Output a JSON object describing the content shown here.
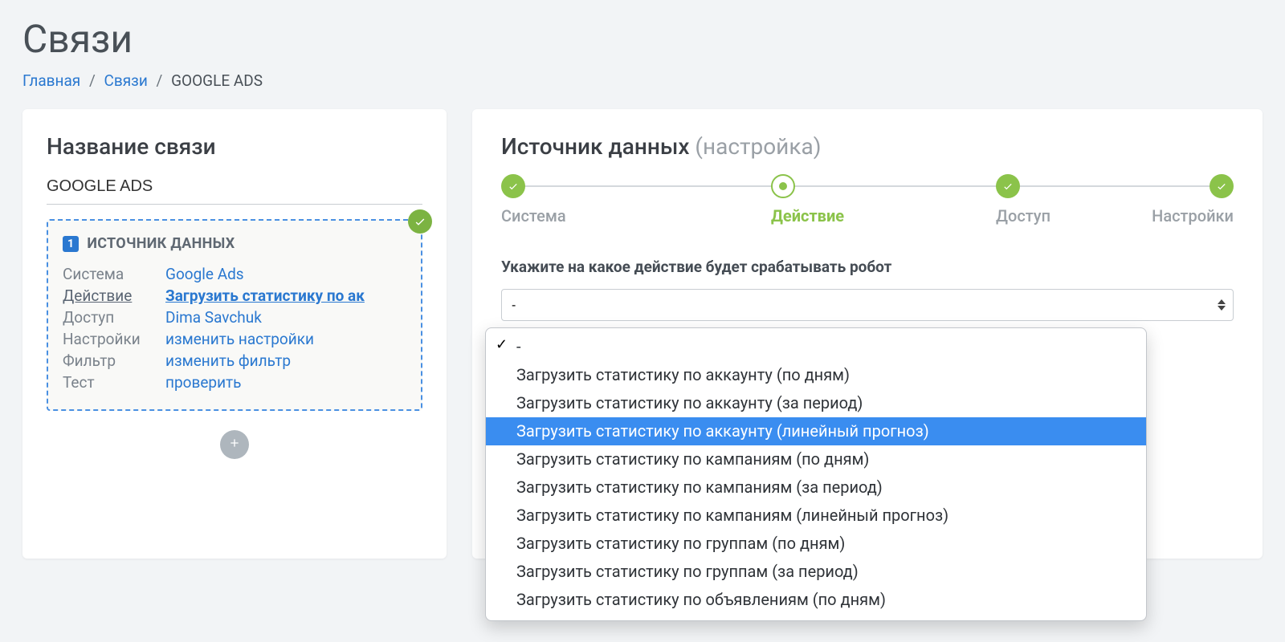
{
  "page": {
    "title": "Связи"
  },
  "breadcrumb": {
    "items": [
      {
        "label": "Главная",
        "link": true
      },
      {
        "label": "Связи",
        "link": true
      },
      {
        "label": "GOOGLE ADS",
        "link": false
      }
    ]
  },
  "left": {
    "title": "Название связи",
    "connection_name": "GOOGLE ADS",
    "source_block": {
      "step_number": "1",
      "header": "ИСТОЧНИК ДАННЫХ",
      "rows": [
        {
          "key": "Система",
          "value": "Google Ads",
          "active": false
        },
        {
          "key": "Действие",
          "value": "Загрузить статистику по ак",
          "active": true
        },
        {
          "key": "Доступ",
          "value": "Dima Savchuk",
          "active": false
        },
        {
          "key": "Настройки",
          "value": "изменить настройки",
          "active": false
        },
        {
          "key": "Фильтр",
          "value": "изменить фильтр",
          "active": false
        },
        {
          "key": "Тест",
          "value": "проверить",
          "active": false
        }
      ]
    }
  },
  "right": {
    "title_main": "Источник данных",
    "title_muted": "(настройка)",
    "steps": [
      {
        "label": "Система",
        "state": "done"
      },
      {
        "label": "Действие",
        "state": "current"
      },
      {
        "label": "Доступ",
        "state": "done"
      },
      {
        "label": "Настройки",
        "state": "done"
      }
    ],
    "prompt": "Укажите на какое действие будет срабатывать робот",
    "select_value": "-"
  },
  "dropdown": {
    "items": [
      {
        "label": "-",
        "checked": true,
        "highlight": false
      },
      {
        "label": "Загрузить статистику по аккаунту (по дням)",
        "checked": false,
        "highlight": false
      },
      {
        "label": "Загрузить статистику по аккаунту (за период)",
        "checked": false,
        "highlight": false
      },
      {
        "label": "Загрузить статистику по аккаунту (линейный прогноз)",
        "checked": false,
        "highlight": true
      },
      {
        "label": "Загрузить статистику по кампаниям (по дням)",
        "checked": false,
        "highlight": false
      },
      {
        "label": "Загрузить статистику по кампаниям (за период)",
        "checked": false,
        "highlight": false
      },
      {
        "label": "Загрузить статистику по кампаниям (линейный прогноз)",
        "checked": false,
        "highlight": false
      },
      {
        "label": "Загрузить статистику по группам (по дням)",
        "checked": false,
        "highlight": false
      },
      {
        "label": "Загрузить статистику по группам (за период)",
        "checked": false,
        "highlight": false
      },
      {
        "label": "Загрузить статистику по объявлениям (по дням)",
        "checked": false,
        "highlight": false
      }
    ]
  }
}
